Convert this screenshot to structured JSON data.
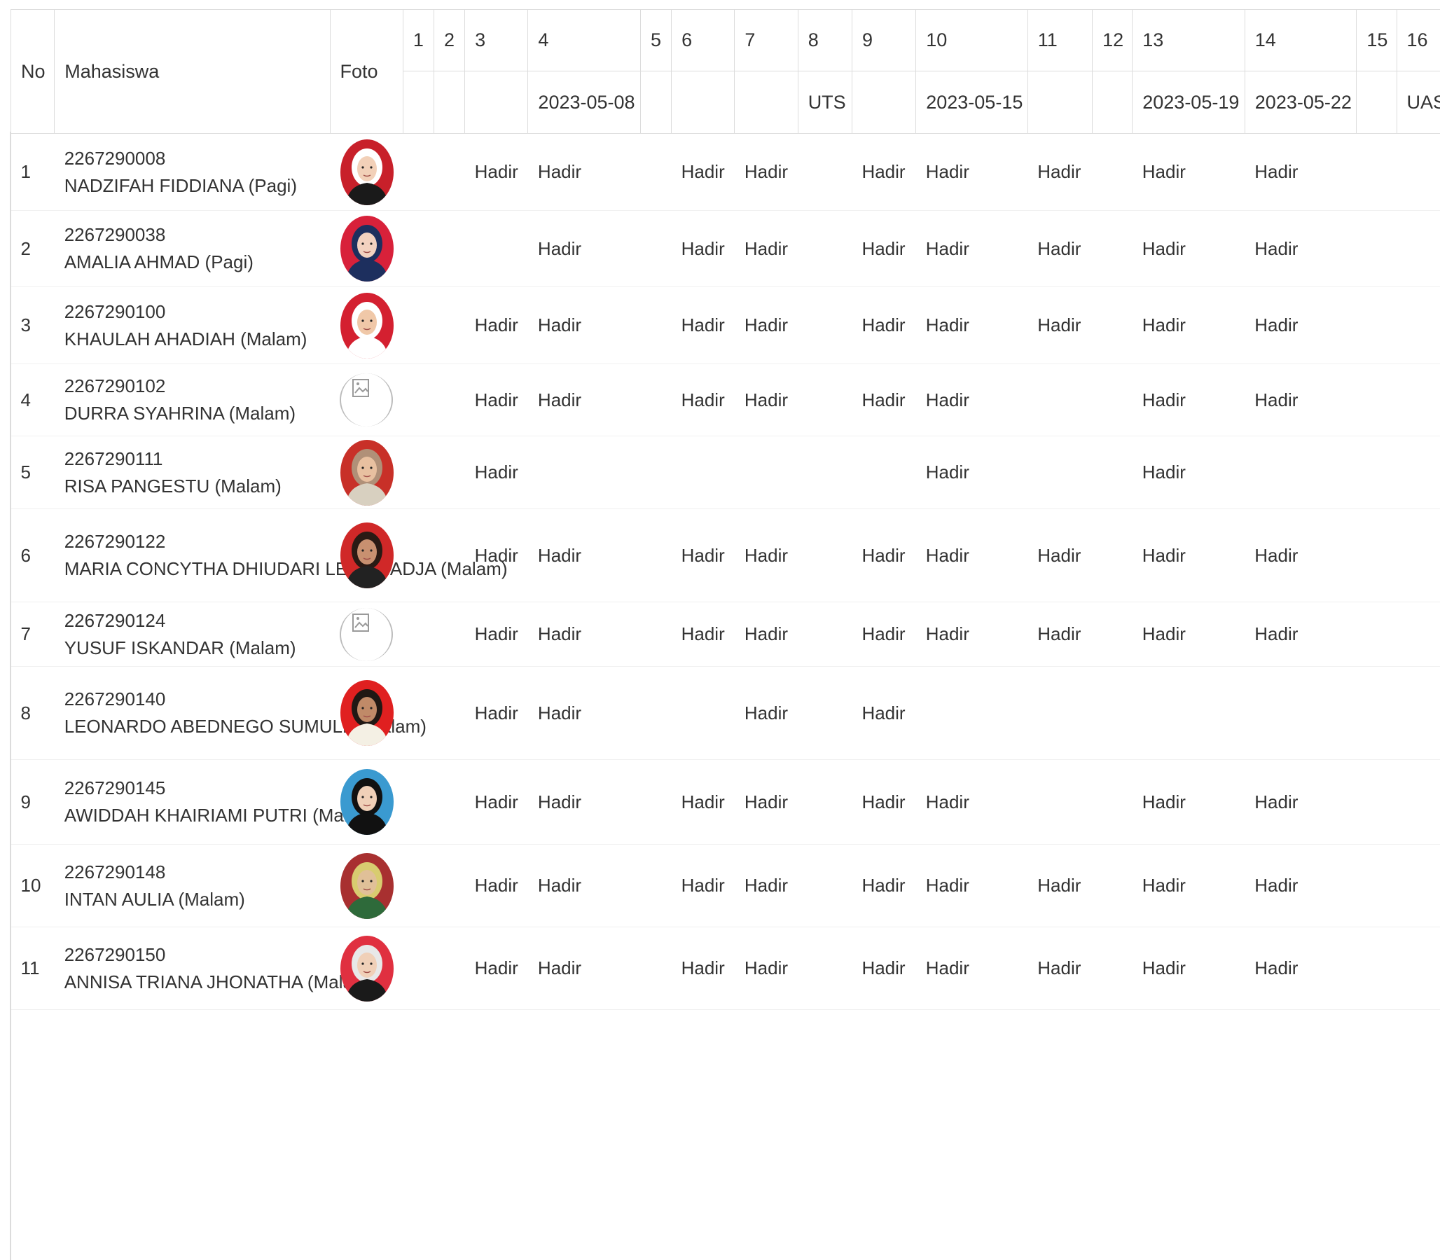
{
  "header": {
    "no": "No",
    "student": "Mahasiswa",
    "photo": "Foto",
    "meetings": [
      {
        "num": "1",
        "date": ""
      },
      {
        "num": "2",
        "date": ""
      },
      {
        "num": "3",
        "date": ""
      },
      {
        "num": "4",
        "date": "2023-05-08"
      },
      {
        "num": "5",
        "date": ""
      },
      {
        "num": "6",
        "date": ""
      },
      {
        "num": "7",
        "date": ""
      },
      {
        "num": "8",
        "date": "UTS"
      },
      {
        "num": "9",
        "date": ""
      },
      {
        "num": "10",
        "date": "2023-05-15"
      },
      {
        "num": "11",
        "date": ""
      },
      {
        "num": "12",
        "date": ""
      },
      {
        "num": "13",
        "date": "2023-05-19"
      },
      {
        "num": "14",
        "date": "2023-05-22"
      },
      {
        "num": "15",
        "date": ""
      },
      {
        "num": "16",
        "date": "UAS"
      }
    ]
  },
  "rows": [
    {
      "no": "1",
      "nim": "2267290008",
      "name": "NADZIFAH FIDDIANA (Pagi)",
      "photo": "photo",
      "bg": "#c8202a",
      "skin": "#f2d0b8",
      "hijab": "#ffffff",
      "top": "#1a1a1a",
      "att": [
        "",
        "",
        "Hadir",
        "Hadir",
        "",
        "Hadir",
        "Hadir",
        "",
        "Hadir",
        "Hadir",
        "Hadir",
        "",
        "Hadir",
        "Hadir",
        "",
        ""
      ]
    },
    {
      "no": "2",
      "nim": "2267290038",
      "name": "AMALIA AHMAD (Pagi)",
      "photo": "photo",
      "bg": "#d8213a",
      "skin": "#f3d2c0",
      "hijab": "#1d2f5e",
      "top": "#1d2f5e",
      "att": [
        "",
        "",
        "",
        "Hadir",
        "",
        "Hadir",
        "Hadir",
        "",
        "Hadir",
        "Hadir",
        "Hadir",
        "",
        "Hadir",
        "Hadir",
        "",
        ""
      ]
    },
    {
      "no": "3",
      "nim": "2267290100",
      "name": "KHAULAH AHADIAH (Malam)",
      "photo": "photo",
      "bg": "#d42030",
      "skin": "#f0c8a8",
      "hijab": "#ffffff",
      "top": "#ffffff",
      "att": [
        "",
        "",
        "Hadir",
        "Hadir",
        "",
        "Hadir",
        "Hadir",
        "",
        "Hadir",
        "Hadir",
        "Hadir",
        "",
        "Hadir",
        "Hadir",
        "",
        ""
      ]
    },
    {
      "no": "4",
      "nim": "2267290102",
      "name": "DURRA SYAHRINA (Malam)",
      "photo": "broken",
      "att": [
        "",
        "",
        "Hadir",
        "Hadir",
        "",
        "Hadir",
        "Hadir",
        "",
        "Hadir",
        "Hadir",
        "",
        "",
        "Hadir",
        "Hadir",
        "",
        ""
      ]
    },
    {
      "no": "5",
      "nim": "2267290111",
      "name": "RISA PANGESTU (Malam)",
      "photo": "photo",
      "bg": "#c83028",
      "skin": "#e8c0a0",
      "hijab": "#b09078",
      "top": "#d8d0c0",
      "att": [
        "",
        "",
        "Hadir",
        "",
        "",
        "",
        "",
        "",
        "",
        "Hadir",
        "",
        "",
        "Hadir",
        "",
        "",
        ""
      ]
    },
    {
      "no": "6",
      "nim": "2267290122",
      "name": "MARIA CONCYTHA DHIUDARI LELE MADJA (Malam)",
      "photo": "photo",
      "bg": "#d02828",
      "skin": "#c89070",
      "hijab": "#2a1a14",
      "top": "#222222",
      "att": [
        "",
        "",
        "Hadir",
        "Hadir",
        "",
        "Hadir",
        "Hadir",
        "",
        "Hadir",
        "Hadir",
        "Hadir",
        "",
        "Hadir",
        "Hadir",
        "",
        ""
      ]
    },
    {
      "no": "7",
      "nim": "2267290124",
      "name": "YUSUF ISKANDAR (Malam)",
      "photo": "broken",
      "att": [
        "",
        "",
        "Hadir",
        "Hadir",
        "",
        "Hadir",
        "Hadir",
        "",
        "Hadir",
        "Hadir",
        "Hadir",
        "",
        "Hadir",
        "Hadir",
        "",
        ""
      ]
    },
    {
      "no": "8",
      "nim": "2267290140",
      "name": "LEONARDO ABEDNEGO SUMULE (Malam)",
      "photo": "photo",
      "bg": "#e02020",
      "skin": "#c08a68",
      "hijab": "#201814",
      "top": "#f4f0e4",
      "att": [
        "",
        "",
        "Hadir",
        "Hadir",
        "",
        "",
        "Hadir",
        "",
        "Hadir",
        "",
        "",
        "",
        "",
        "",
        "",
        ""
      ]
    },
    {
      "no": "9",
      "nim": "2267290145",
      "name": "AWIDDAH KHAIRIAMI PUTRI (Malam)",
      "photo": "photo",
      "bg": "#3a9ad0",
      "skin": "#f0d0b8",
      "hijab": "#111111",
      "top": "#111111",
      "att": [
        "",
        "",
        "Hadir",
        "Hadir",
        "",
        "Hadir",
        "Hadir",
        "",
        "Hadir",
        "Hadir",
        "",
        "",
        "Hadir",
        "Hadir",
        "",
        ""
      ]
    },
    {
      "no": "10",
      "nim": "2267290148",
      "name": "INTAN AULIA (Malam)",
      "photo": "photo",
      "bg": "#a83030",
      "skin": "#e0c098",
      "hijab": "#d8cc70",
      "top": "#2e6a3a",
      "att": [
        "",
        "",
        "Hadir",
        "Hadir",
        "",
        "Hadir",
        "Hadir",
        "",
        "Hadir",
        "Hadir",
        "Hadir",
        "",
        "Hadir",
        "Hadir",
        "",
        ""
      ]
    },
    {
      "no": "11",
      "nim": "2267290150",
      "name": "ANNISA TRIANA JHONATHA (Malam)",
      "photo": "photo",
      "bg": "#e03040",
      "skin": "#f0d0b8",
      "hijab": "#e8e8e8",
      "top": "#1a1a1a",
      "att": [
        "",
        "",
        "Hadir",
        "Hadir",
        "",
        "Hadir",
        "Hadir",
        "",
        "Hadir",
        "Hadir",
        "Hadir",
        "",
        "Hadir",
        "Hadir",
        "",
        ""
      ]
    }
  ]
}
